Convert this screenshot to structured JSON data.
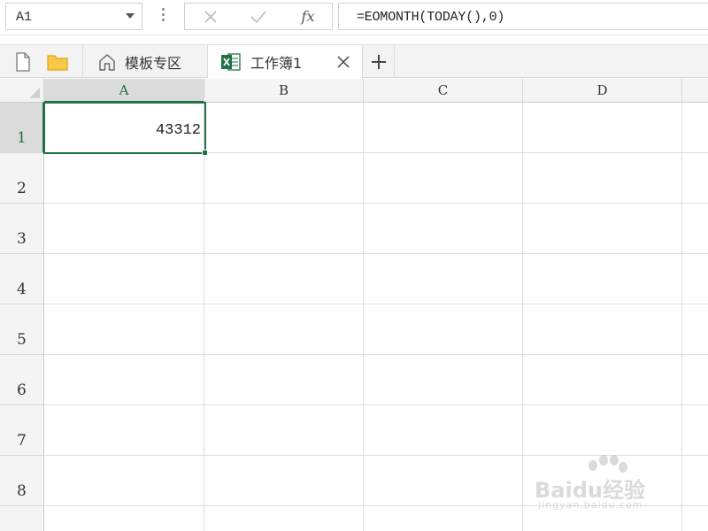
{
  "formula_bar": {
    "name_box": "A1",
    "formula": "=EOMONTH(TODAY(),0)",
    "fx_label": "fx"
  },
  "tabs": {
    "templates_label": "模板专区",
    "workbook_label": "工作簿1"
  },
  "grid": {
    "columns": [
      "A",
      "B",
      "C",
      "D"
    ],
    "rows": [
      "1",
      "2",
      "3",
      "4",
      "5",
      "6",
      "7",
      "8"
    ],
    "active_cell": "A1",
    "cells": {
      "A1": "43312"
    }
  },
  "watermark": {
    "brand": "Baidu经验",
    "url": "jingyan.baidu.com"
  },
  "colors": {
    "accent_green": "#217346",
    "grid_line": "#dedede",
    "header_bg": "#f4f4f4"
  }
}
